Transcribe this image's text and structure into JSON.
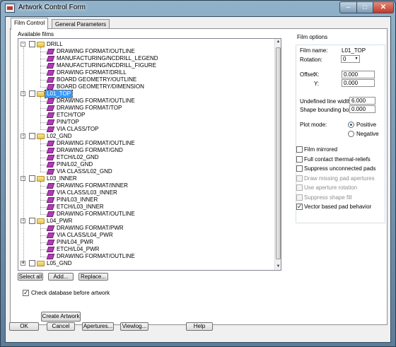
{
  "window": {
    "title": "Artwork Control Form"
  },
  "tabs": [
    "Film Control",
    "General Parameters"
  ],
  "available_films_label": "Available films",
  "tree": [
    {
      "text": "DRILL",
      "level": 0,
      "expander": "-",
      "selected": false
    },
    {
      "text": "DRAWING FORMAT/OUTLINE",
      "level": 1
    },
    {
      "text": "MANUFACTURING/NCDRILL_LEGEND",
      "level": 1
    },
    {
      "text": "MANUFACTURING/NCDRILL_FIGURE",
      "level": 1
    },
    {
      "text": "DRAWING FORMAT/DRILL",
      "level": 1
    },
    {
      "text": "BOARD GEOMETRY/OUTLINE",
      "level": 1
    },
    {
      "text": "BOARD GEOMETRY/DIMENSION",
      "level": 1
    },
    {
      "text": "L01_TOP",
      "level": 0,
      "expander": "-",
      "selected": true
    },
    {
      "text": "DRAWING FORMAT/OUTLINE",
      "level": 1
    },
    {
      "text": "DRAWING FORMAT/TOP",
      "level": 1
    },
    {
      "text": "ETCH/TOP",
      "level": 1
    },
    {
      "text": "PIN/TOP",
      "level": 1
    },
    {
      "text": "VIA CLASS/TOP",
      "level": 1
    },
    {
      "text": "L02_GND",
      "level": 0,
      "expander": "-",
      "selected": false
    },
    {
      "text": "DRAWING FORMAT/OUTLINE",
      "level": 1
    },
    {
      "text": "DRAWING FORMAT/GND",
      "level": 1
    },
    {
      "text": "ETCH/L02_GND",
      "level": 1
    },
    {
      "text": "PIN/L02_GND",
      "level": 1
    },
    {
      "text": "VIA CLASS/L02_GND",
      "level": 1
    },
    {
      "text": "L03_INNER",
      "level": 0,
      "expander": "-",
      "selected": false
    },
    {
      "text": "DRAWING FORMAT/INNER",
      "level": 1
    },
    {
      "text": "VIA CLASS/L03_INNER",
      "level": 1
    },
    {
      "text": "PIN/L03_INNER",
      "level": 1
    },
    {
      "text": "ETCH/L03_INNER",
      "level": 1
    },
    {
      "text": "DRAWING FORMAT/OUTLINE",
      "level": 1
    },
    {
      "text": "L04_PWR",
      "level": 0,
      "expander": "-",
      "selected": false
    },
    {
      "text": "DRAWING FORMAT/PWR",
      "level": 1
    },
    {
      "text": "VIA CLASS/L04_PWR",
      "level": 1
    },
    {
      "text": "PIN/L04_PWR",
      "level": 1
    },
    {
      "text": "ETCH/L04_PWR",
      "level": 1
    },
    {
      "text": "DRAWING FORMAT/OUTLINE",
      "level": 1
    },
    {
      "text": "L05_GND",
      "level": 0,
      "expander": "+",
      "selected": false
    }
  ],
  "list_buttons": {
    "select_all": "Select all",
    "add": "Add...",
    "replace": "Replace..."
  },
  "check_database": {
    "label": "Check database before artwork",
    "checked": true
  },
  "create_artwork": "Create Artwork",
  "film_options": {
    "heading": "Film options",
    "film_name_label": "Film name:",
    "film_name_value": "L01_TOP",
    "rotation_label": "Rotation:",
    "rotation_value": "0",
    "offset_label": "Offset",
    "x_label": "X:",
    "x_value": "0.000",
    "y_label": "Y:",
    "y_value": "0.000",
    "undefined_line_width_label": "Undefined line width:",
    "undefined_line_width_value": "6.000",
    "shape_bounding_box_label": "Shape bounding box:",
    "shape_bounding_box_value": "0.000",
    "plot_mode_label": "Plot mode:",
    "plot_mode_options": [
      "Positive",
      "Negative"
    ],
    "plot_mode_selected": "Positive",
    "checks": [
      {
        "label": "Film mirrored",
        "checked": false,
        "enabled": true
      },
      {
        "label": "Full contact thermal-reliefs",
        "checked": false,
        "enabled": true
      },
      {
        "label": "Suppress unconnected pads",
        "checked": false,
        "enabled": true
      },
      {
        "label": "Draw missing pad apertures",
        "checked": false,
        "enabled": false
      },
      {
        "label": "Use aperture rotation",
        "checked": false,
        "enabled": false
      },
      {
        "label": "Suppress shape fill",
        "checked": false,
        "enabled": false
      },
      {
        "label": "Vector based pad behavior",
        "checked": true,
        "enabled": true
      }
    ]
  },
  "bottom_buttons": {
    "ok": "OK",
    "cancel": "Cancel",
    "apertures": "Apertures...",
    "viewlog": "Viewlog...",
    "help": "Help"
  },
  "colors": {
    "selection": "#3399ff",
    "film_icon": "#b03bb4",
    "folder": "#f0d66e"
  },
  "icons": {
    "folder": "folder-icon",
    "film": "film-layer-icon"
  }
}
